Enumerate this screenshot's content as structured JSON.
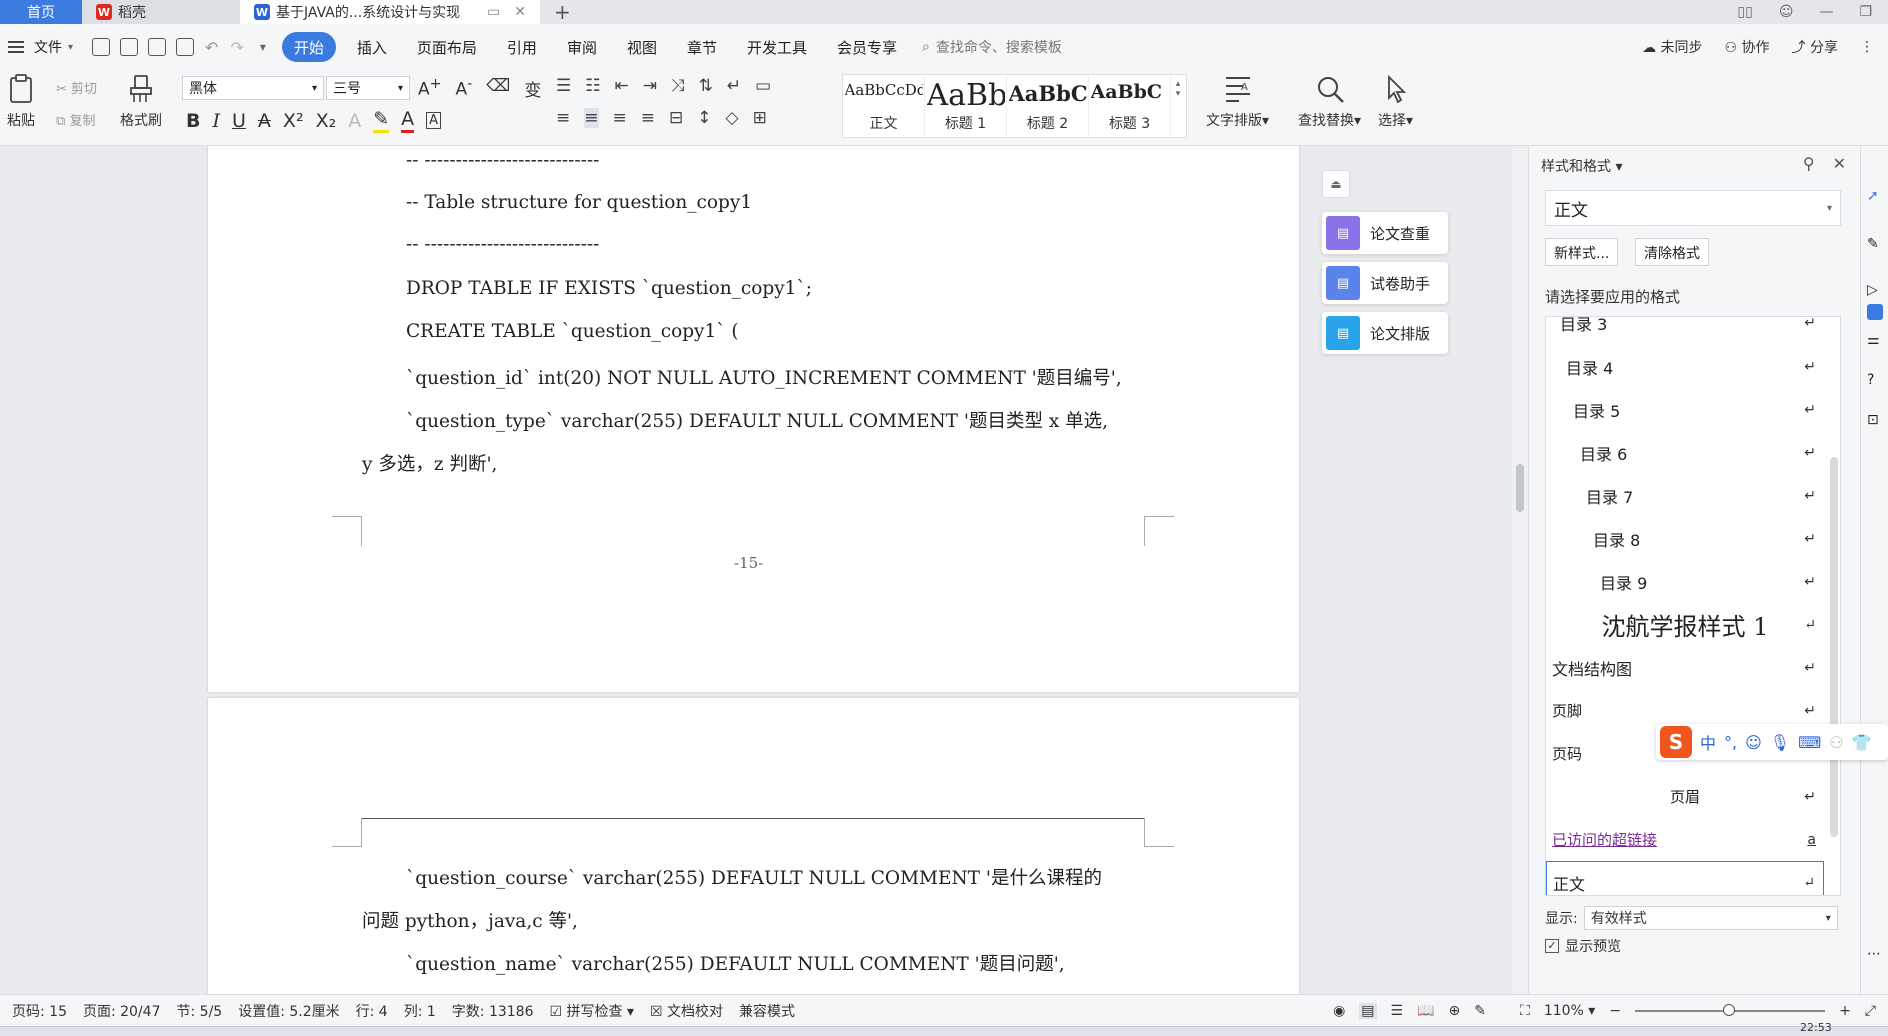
{
  "tabs": {
    "home": "首页",
    "daoke": "稻壳",
    "doc": "基于JAVA的...系统设计与实现"
  },
  "menu": {
    "file": "文件",
    "items": [
      "开始",
      "插入",
      "页面布局",
      "引用",
      "审阅",
      "视图",
      "章节",
      "开发工具",
      "会员专享"
    ],
    "search_placeholder": "查找命令、搜索模板",
    "unsynced": "未同步",
    "collab": "协作",
    "share": "分享"
  },
  "ribbon": {
    "paste": "粘贴",
    "cut": "剪切",
    "copy": "复制",
    "format_painter": "格式刷",
    "font_name": "黑体",
    "font_size": "三号",
    "styles": [
      {
        "sample": "AaBbCcDd",
        "name": "正文"
      },
      {
        "sample": "AaBb",
        "name": "标题 1"
      },
      {
        "sample": "AaBbC",
        "name": "标题 2"
      },
      {
        "sample": "AaBbC",
        "name": "标题 3"
      }
    ],
    "text_layout": "文字排版",
    "find_replace": "查找替换",
    "select": "选择"
  },
  "document": {
    "page1_lines": [
      "-- ----------------------------",
      "-- Table structure for question_copy1",
      "-- ----------------------------",
      "DROP TABLE IF EXISTS `question_copy1`;",
      "CREATE TABLE `question_copy1` (",
      "  `question_id` int(20) NOT NULL AUTO_INCREMENT COMMENT '题目编号',",
      "  `question_type` varchar(255) DEFAULT NULL COMMENT '题目类型 x 单选,",
      "y 多选，z 判断',"
    ],
    "page_number": "-15-",
    "page2_lines": [
      "  `question_course` varchar(255) DEFAULT NULL COMMENT '是什么课程的",
      "问题 python，java,c 等',",
      "  `question_name` varchar(255) DEFAULT NULL COMMENT '题目问题',"
    ]
  },
  "helpers": [
    "论文查重",
    "试卷助手",
    "论文排版"
  ],
  "panel": {
    "title": "样式和格式",
    "current_style": "正文",
    "new_style": "新样式...",
    "clear_format": "清除格式",
    "prompt": "请选择要应用的格式",
    "styles": [
      "目录 3",
      "目录 4",
      "目录 5",
      "目录 6",
      "目录 7",
      "目录 8",
      "目录 9",
      "沈航学报样式 1",
      "文档结构图",
      "页脚",
      "页码",
      "页眉",
      "已访问的超链接",
      "正文"
    ],
    "show_label": "显示:",
    "show_value": "有效样式",
    "preview_label": "显示预览"
  },
  "ime": {
    "logo": "S",
    "lang": "中"
  },
  "status": {
    "page_code": "页码: 15",
    "page": "页面: 20/47",
    "section": "节: 5/5",
    "setting": "设置值: 5.2厘米",
    "row": "行: 4",
    "col": "列: 1",
    "words": "字数: 13186",
    "spell": "拼写检查",
    "proof": "文档校对",
    "compat": "兼容模式",
    "zoom": "110%"
  },
  "taskbar": {
    "clock": "22:53"
  },
  "colors": {
    "accent": "#3b7be0",
    "wps_red": "#e0281e",
    "ime_orange": "#f0561e",
    "link_purple": "#7a2c9a"
  }
}
